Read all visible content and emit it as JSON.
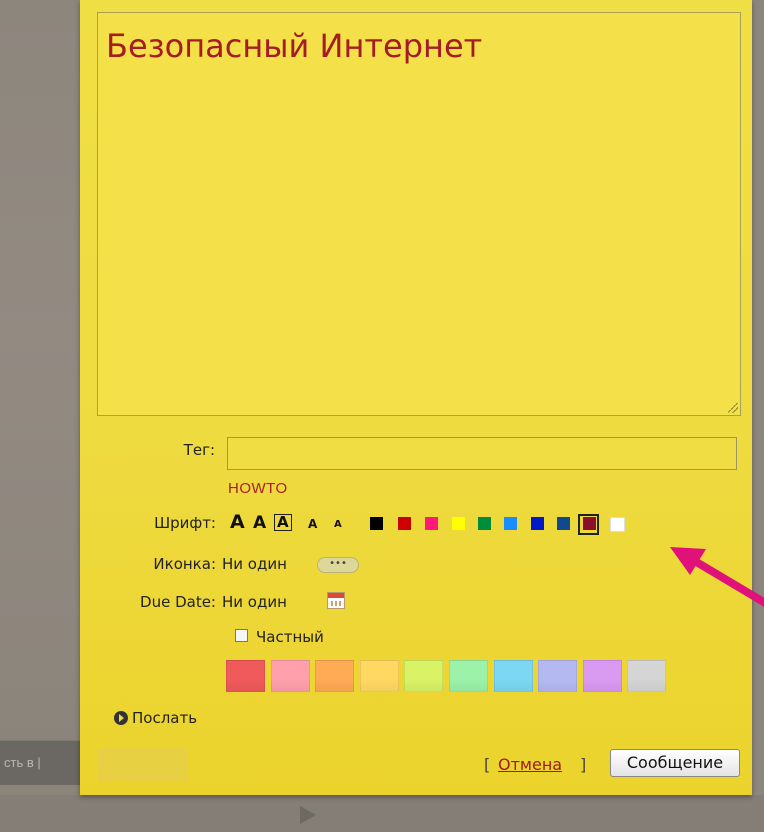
{
  "background": {
    "strip_text": "сть в |"
  },
  "note": {
    "title_text": "Безопасный Интернет",
    "tag": {
      "label": "Тег:",
      "value": "",
      "suggestion": "HOWTO"
    },
    "font": {
      "label": "Шрифт:",
      "sizes": [
        "A",
        "A",
        "A",
        "A",
        "A"
      ],
      "colors": [
        "#000000",
        "#cc0000",
        "#ff1a75",
        "#ffff00",
        "#008c3a",
        "#1a8cff",
        "#0019c8",
        "#104a8e",
        "#8b0f2a",
        "#ffffff"
      ],
      "selected_color": "#8b0f2a"
    },
    "icon": {
      "label": "Иконка:",
      "value": "Ни один",
      "picker_glyph": "•••"
    },
    "due_date": {
      "label": "Due Date:",
      "value": "Ни один"
    },
    "private": {
      "label": "Частный",
      "checked": false
    },
    "note_colors": [
      "#f05a5a",
      "#ffa0ac",
      "#ffaa55",
      "#ffd862",
      "#d9f266",
      "#9cf2a8",
      "#7cd8f2",
      "#b5b9f2",
      "#d99af2",
      "#d5d5d5"
    ],
    "send": {
      "label": "Послать"
    },
    "actions": {
      "open_bracket": "[",
      "cancel_label": "Отмена",
      "close_bracket": "]",
      "submit_label": "Сообщение"
    }
  },
  "accent_color": "#e0127a"
}
